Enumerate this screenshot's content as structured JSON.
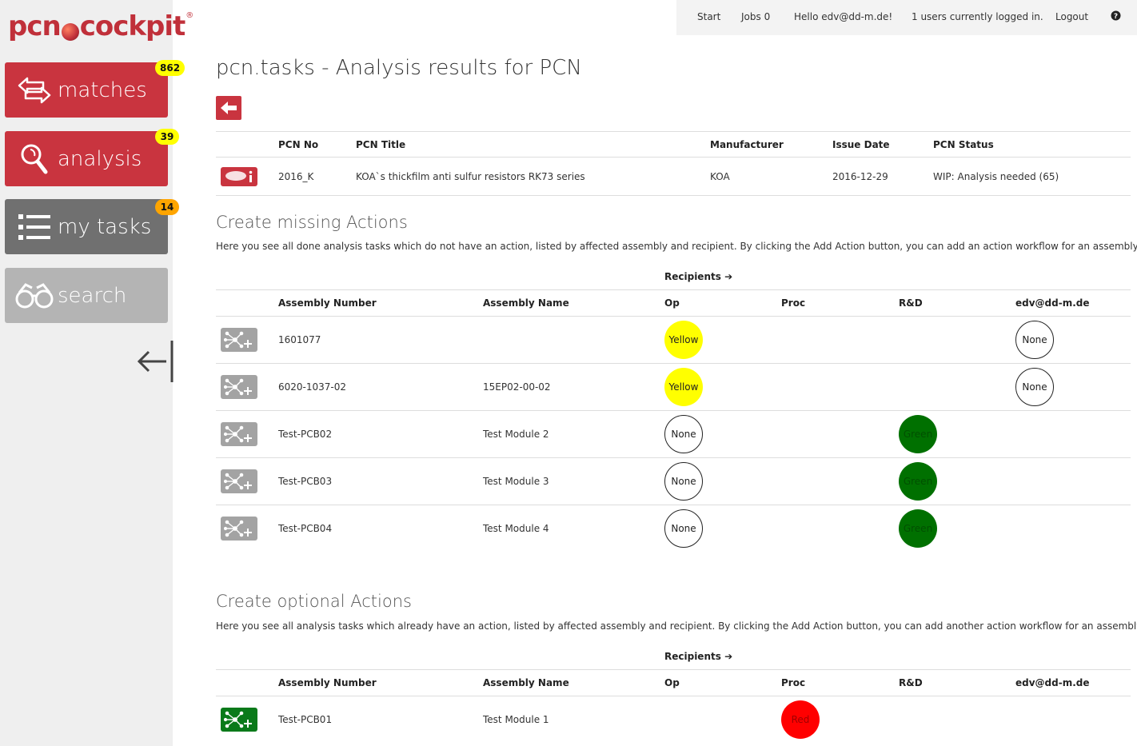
{
  "logo": {
    "text_a": "pcn",
    "text_b": "cockpit",
    "reg": "®"
  },
  "sidebar": {
    "items": [
      {
        "label": "matches",
        "badge": "862",
        "badge_color": "#ffff00"
      },
      {
        "label": "analysis",
        "badge": "39",
        "badge_color": "#ffff00"
      },
      {
        "label": "my tasks",
        "badge": "14",
        "badge_color": "#ffa500"
      },
      {
        "label": "search"
      }
    ]
  },
  "topnav": {
    "start": "Start",
    "jobs": "Jobs 0",
    "hello": "Hello edv@dd-m.de!",
    "users": "1 users currently logged in.",
    "logout": "Logout"
  },
  "page": {
    "title": "pcn.tasks - Analysis results for PCN"
  },
  "pcn_table": {
    "headers": [
      "PCN No",
      "PCN Title",
      "Manufacturer",
      "Issue Date",
      "PCN Status"
    ],
    "row": {
      "no": "2016_K",
      "title": "KOA`s thickfilm anti sulfur resistors RK73 series",
      "manufacturer": "KOA",
      "date": "2016-12-29",
      "status": "WIP: Analysis needed (65)"
    }
  },
  "missing": {
    "title": "Create missing Actions",
    "desc": "Here you see all done analysis tasks which do not have an action, listed by affected assembly and recipient. By clicking the Add Action button, you can add an action workflow for an assembly.",
    "recipients": "Recipients",
    "headers": [
      "Assembly Number",
      "Assembly Name",
      "Op",
      "Proc",
      "R&D",
      "edv@dd-m.de"
    ],
    "rows": [
      {
        "number": "1601077",
        "name": "",
        "op": "Yellow",
        "proc": "",
        "rd": "",
        "edv": "None"
      },
      {
        "number": "6020-1037-02",
        "name": "15EP02-00-02",
        "op": "Yellow",
        "proc": "",
        "rd": "",
        "edv": "None"
      },
      {
        "number": "Test-PCB02",
        "name": "Test Module 2",
        "op": "None",
        "proc": "",
        "rd": "Green",
        "edv": ""
      },
      {
        "number": "Test-PCB03",
        "name": "Test Module 3",
        "op": "None",
        "proc": "",
        "rd": "Green",
        "edv": ""
      },
      {
        "number": "Test-PCB04",
        "name": "Test Module 4",
        "op": "None",
        "proc": "",
        "rd": "Green",
        "edv": ""
      }
    ]
  },
  "optional": {
    "title": "Create optional Actions",
    "desc": "Here you see all analysis tasks which already have an action, listed by affected assembly and recipient. By clicking the Add Action button, you can add another action workflow for an assembly.",
    "recipients": "Recipients",
    "headers": [
      "Assembly Number",
      "Assembly Name",
      "Op",
      "Proc",
      "R&D",
      "edv@dd-m.de"
    ],
    "rows": [
      {
        "number": "Test-PCB01",
        "name": "Test Module 1",
        "op": "",
        "proc": "Red",
        "rd": "",
        "edv": ""
      }
    ]
  }
}
